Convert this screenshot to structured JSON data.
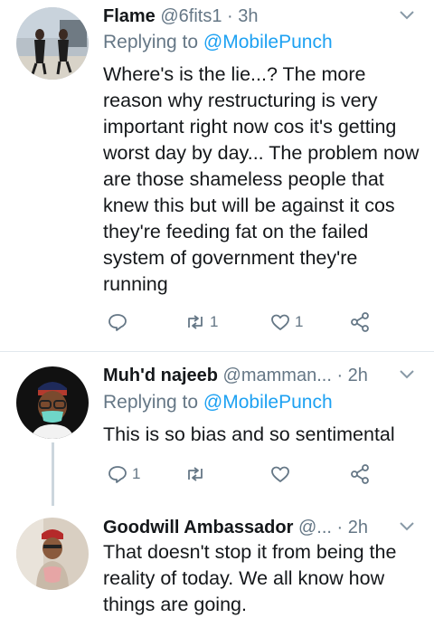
{
  "tweets": [
    {
      "name": "Flame",
      "handle": "@6fits1",
      "dot": "·",
      "time": "3h",
      "replying_prefix": "Replying to ",
      "replying_mention": "@MobilePunch",
      "text": "Where's is the lie...? The more reason why restructuring is very important right now cos it's getting worst day by day... The problem now are those shameless people that knew this but will be against it cos they're feeding fat on the failed system of government they're running",
      "replies": "",
      "retweets": "1",
      "likes": "1"
    },
    {
      "name": "Muh'd najeeb",
      "handle": "@mamman...",
      "dot": "·",
      "time": "2h",
      "replying_prefix": "Replying to ",
      "replying_mention": "@MobilePunch",
      "text": "This is so bias and so sentimental",
      "replies": "1",
      "retweets": "",
      "likes": ""
    },
    {
      "name": "Goodwill Ambassador",
      "handle": "@...",
      "dot": "·",
      "time": "2h",
      "text": "That doesn't stop it from being the reality of today. We all know how things are going."
    }
  ],
  "colors": {
    "accent": "#1da1f2",
    "muted": "#657786",
    "divider": "#e1e8ed"
  }
}
